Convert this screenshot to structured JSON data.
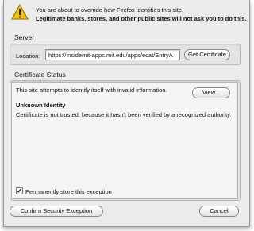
{
  "header": {
    "line1": "You are about to override how Firefox identifies this site.",
    "line2": "Legitimate banks, stores, and other public sites will not ask you to do this."
  },
  "server": {
    "title": "Server",
    "location_label": "Location:",
    "location_value": "https://insidemit-apps.mit.edu/apps/ecat/EntryA",
    "get_cert_label": "Get Certificate"
  },
  "cert_status": {
    "title": "Certificate Status",
    "invalid_info": "This site attempts to identify itself with invalid information.",
    "view_label": "View...",
    "identity_heading": "Unknown Identity",
    "identity_detail": "Certificate is not trusted, because it hasn't been verified by a recognized authority."
  },
  "permanent": {
    "label": "Permanently store this exception",
    "checked": true,
    "check_glyph": "✔"
  },
  "actions": {
    "confirm_label": "Confirm Security Exception",
    "cancel_label": "Cancel"
  },
  "icons": {
    "warning": "warning-triangle-icon"
  },
  "colors": {
    "warning_fill": "#f2c500",
    "dialog_bg": "#ebebeb"
  }
}
